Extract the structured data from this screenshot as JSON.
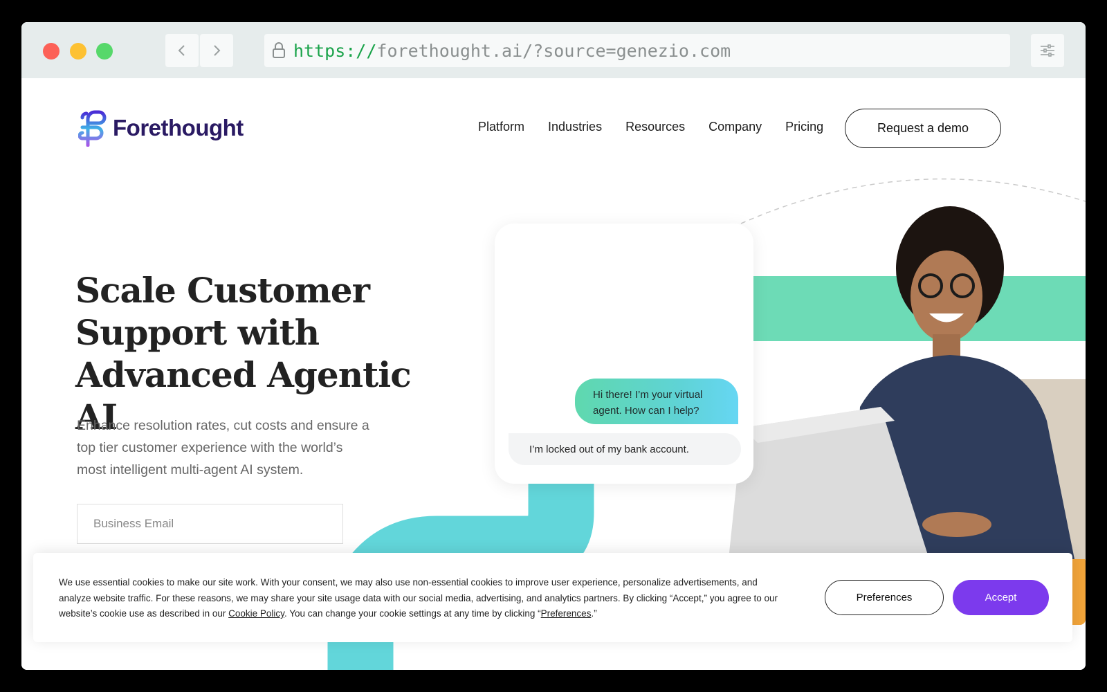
{
  "browser": {
    "url_scheme": "https://",
    "url_rest": "forethought.ai/?source=genezio.com"
  },
  "header": {
    "logo_text": "Forethought",
    "nav": [
      "Platform",
      "Industries",
      "Resources",
      "Company",
      "Pricing"
    ],
    "cta_label": "Request a demo"
  },
  "hero": {
    "title_lines": [
      "Scale Customer",
      "Support with",
      "Advanced Agentic AI"
    ],
    "subtitle_lines": [
      "Enhance resolution rates, cut costs and ensure a",
      "top tier customer experience with the world’s",
      "most intelligent multi-agent AI system."
    ],
    "email_placeholder": "Business Email"
  },
  "chat": {
    "agent_lines": [
      "Hi there! I’m your virtual",
      "agent. How can I help?"
    ],
    "user_message": "I’m locked out of my bank account."
  },
  "cookie_banner": {
    "text_part1": "We use essential cookies to make our site work. With your consent, we may also use non-essential cookies to improve user experience, personalize advertisements, and analyze website traffic. For these reasons, we may share your site usage data with our social media, advertising, and analytics partners. By clicking “Accept,” you agree to our website’s cookie use as described in our ",
    "policy_link": "Cookie Policy",
    "text_part2": ". You can change your cookie settings at any time by clicking “",
    "preferences_link": "Preferences",
    "text_part3": ".”",
    "preferences_button": "Preferences",
    "accept_button": "Accept"
  },
  "colors": {
    "brand_navy": "#2a1a63",
    "accent_purple": "#7c3aed",
    "mint": "#6ddbb6",
    "teal": "#62d6da"
  },
  "icons": [
    "lock-icon",
    "chevron-left-icon",
    "chevron-right-icon",
    "sliders-icon",
    "forethought-logo-icon"
  ]
}
